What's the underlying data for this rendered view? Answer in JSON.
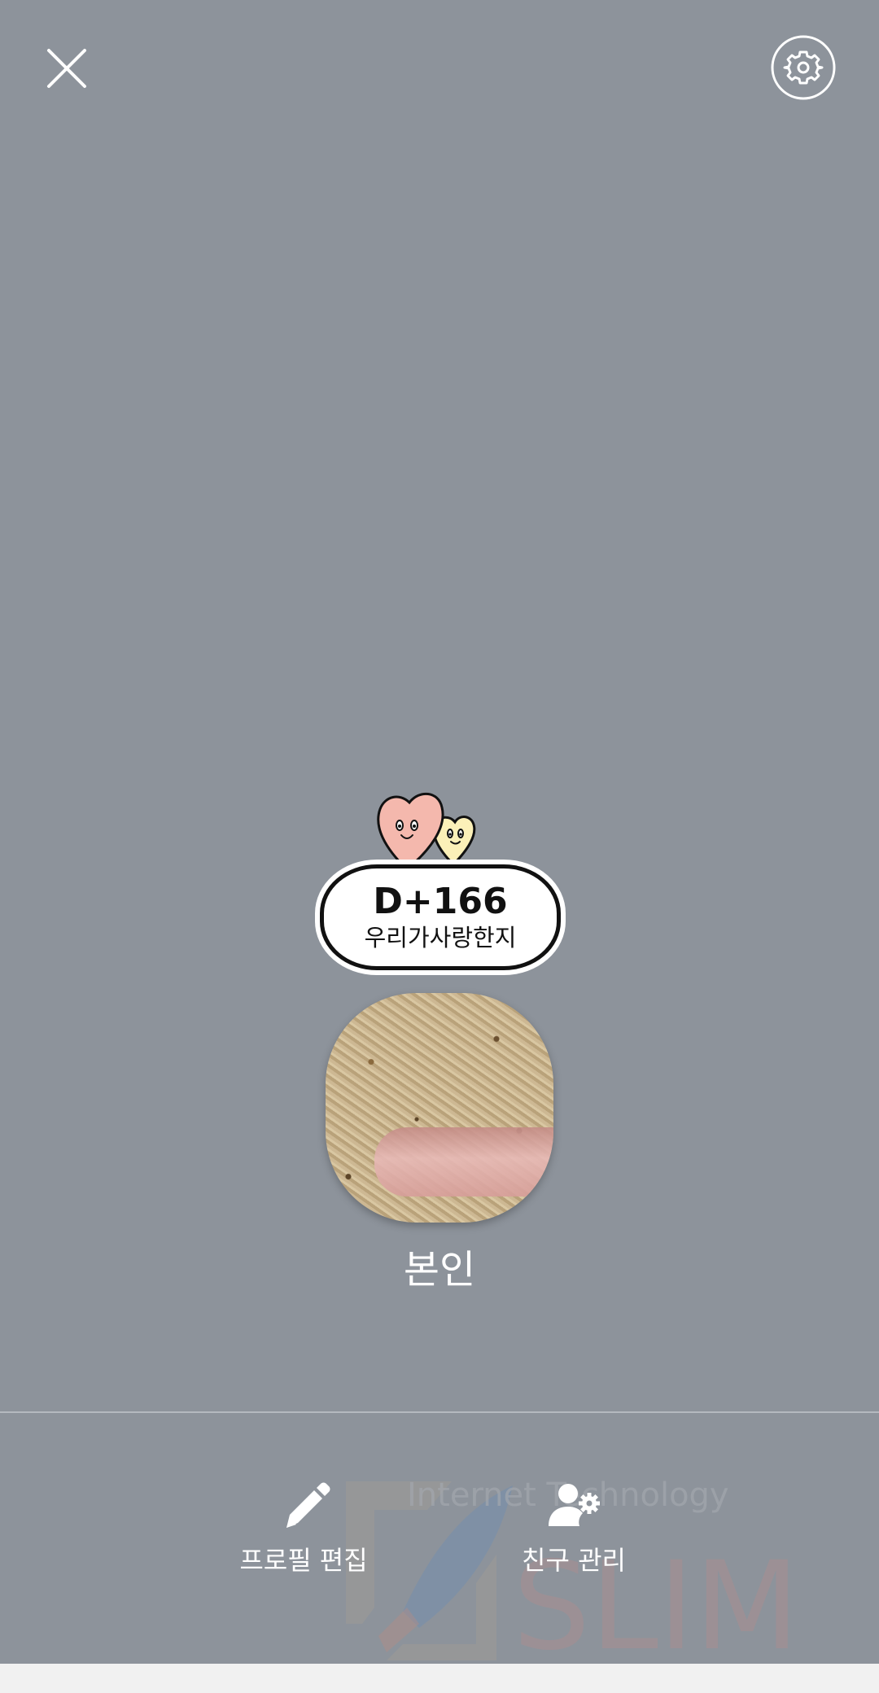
{
  "icons": {
    "close": "close-icon",
    "settings": "gear-icon",
    "edit": "pencil-icon",
    "friends": "person-gear-icon",
    "sticker": "two-hearts-sticker"
  },
  "sticker": {
    "dday": "D+166",
    "caption": "우리가사랑한지"
  },
  "profile": {
    "name": "본인"
  },
  "actions": {
    "edit_profile": "프로필 편집",
    "manage_friends": "친구 관리"
  },
  "watermark": {
    "line1": "Internet Technology",
    "line2": "SLIM"
  },
  "colors": {
    "background": "#8d939b",
    "divider": "#b4b9bf",
    "heart_pink": "#f4b8ad",
    "heart_yellow": "#fbf0b8"
  }
}
